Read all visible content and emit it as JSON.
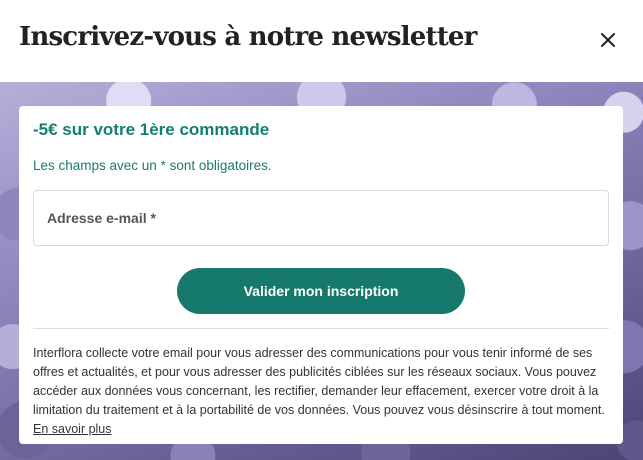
{
  "header": {
    "title": "Inscrivez-vous à notre newsletter",
    "close_icon": "close-icon"
  },
  "card": {
    "promo": "-5€ sur votre 1ère commande",
    "required_note": "Les champs avec un * sont obligatoires.",
    "email_field": {
      "placeholder": "Adresse e-mail *",
      "value": ""
    },
    "submit_label": "Valider mon inscription",
    "legal_text": "Interflora collecte votre email pour vous adresser des communications pour vous tenir informé de ses offres et actualités, et pour vous adresser des publicités ciblées sur les réseaux sociaux. Vous pouvez accéder aux données vous concernant, les rectifier, demander leur effacement, exercer votre droit à la limitation du traitement et à la portabilité de vos données. Vous pouvez vous désinscrire à tout moment.",
    "learn_more": "En savoir plus"
  },
  "colors": {
    "accent": "#157a6b",
    "promo_text": "#157f6f",
    "background_image": "hydrangea-flowers-purple"
  }
}
